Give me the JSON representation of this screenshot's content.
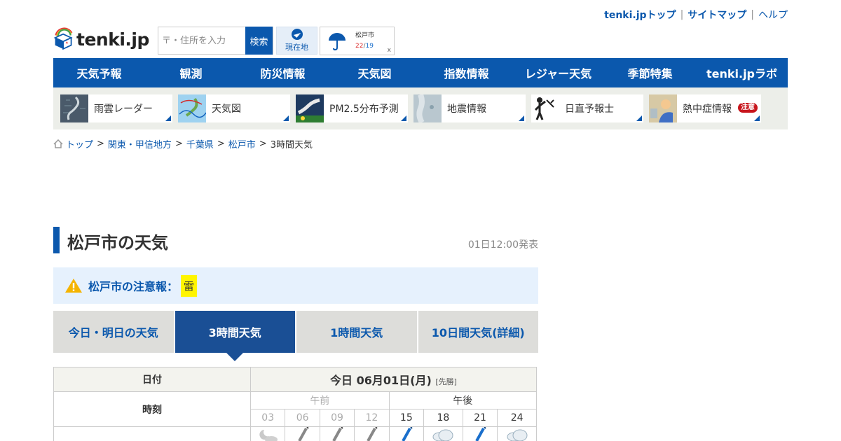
{
  "top_links": {
    "home": "tenki.jpトップ",
    "sitemap": "サイトマップ",
    "help": "ヘルプ"
  },
  "logo": {
    "text": "tenki.jp"
  },
  "search": {
    "placeholder": "〒・住所を入力",
    "button": "検索"
  },
  "geo": {
    "label": "現在地"
  },
  "mini_weather": {
    "city": "松戸市",
    "high": "22",
    "low": "19",
    "close": "x"
  },
  "nav": [
    "天気予報",
    "観測",
    "防災情報",
    "天気図",
    "指数情報",
    "レジャー天気",
    "季節特集",
    "tenki.jpラボ"
  ],
  "subnav": [
    {
      "label": "雨雲レーダー",
      "icon": "radar-thumbnail"
    },
    {
      "label": "天気図",
      "icon": "weather-map-thumbnail"
    },
    {
      "label": "PM2.5分布予測",
      "icon": "pm25-thumbnail"
    },
    {
      "label": "地震情報",
      "icon": "earthquake-thumbnail"
    },
    {
      "label": "日直予報士",
      "icon": "forecaster-thumbnail"
    },
    {
      "label": "熱中症情報",
      "icon": "heatstroke-thumbnail",
      "badge": "注意"
    }
  ],
  "breadcrumb": [
    "トップ",
    "関東・甲信地方",
    "千葉県",
    "松戸市",
    "3時間天気"
  ],
  "page": {
    "title": "松戸市の天気",
    "published": "01日12:00発表"
  },
  "warning": {
    "text": "松戸市の注意報：",
    "item": "雷"
  },
  "tabs": [
    "今日・明日の天気",
    "3時間天気",
    "1時間天気",
    "10日間天気(詳細)"
  ],
  "table": {
    "date_label": "日付",
    "date": "今日 06月01日(月)",
    "rokuyo": "[先勝]",
    "time_label": "時刻",
    "am": "午前",
    "pm": "午後",
    "hours": [
      "03",
      "06",
      "09",
      "12",
      "15",
      "18",
      "21",
      "24"
    ],
    "weather_icons": [
      "moon-cloud-icon",
      "umbrella-closed-icon",
      "umbrella-closed-icon",
      "umbrella-closed-icon",
      "umbrella-rain-icon",
      "cloud-icon",
      "umbrella-rain-icon",
      "cloud-icon"
    ]
  },
  "colors": {
    "brand": "#0b58ad",
    "active_tab": "#1a4f95",
    "warn_bg": "#e6f1fd",
    "warn_badge": "#fff500"
  }
}
